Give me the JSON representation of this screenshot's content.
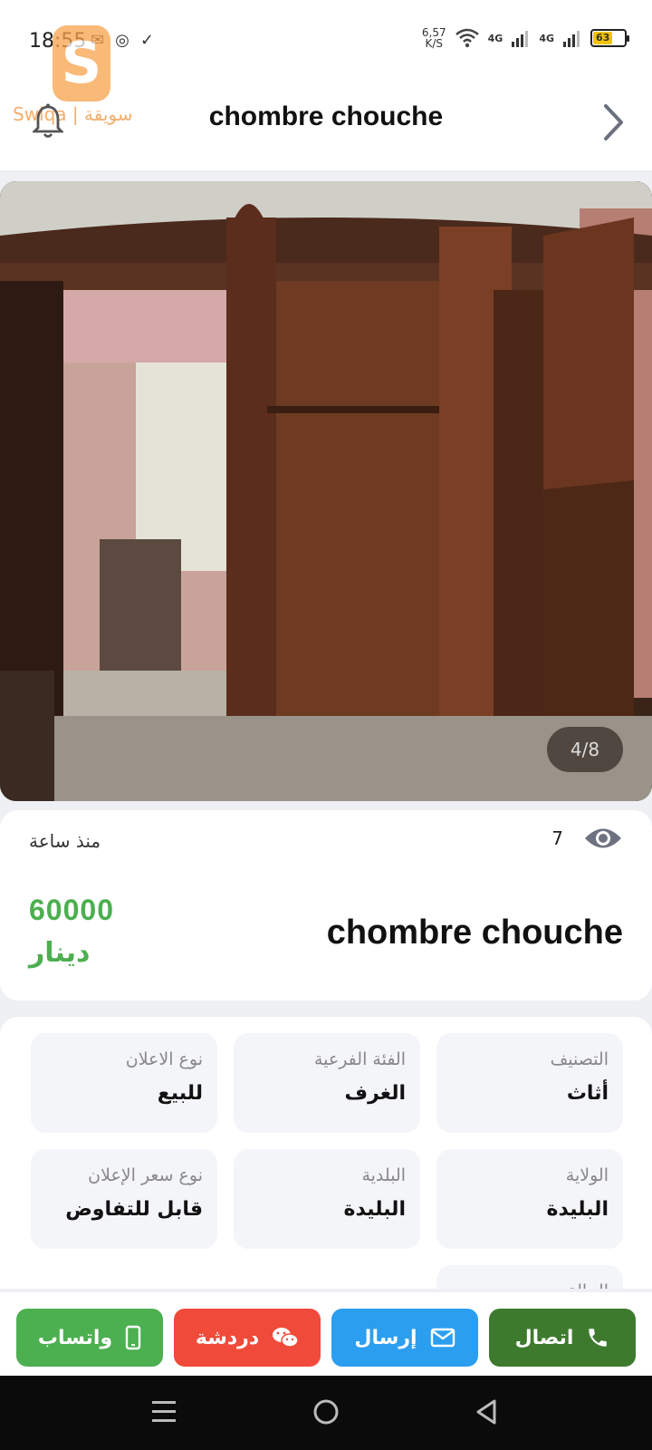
{
  "status_bar": {
    "time": "18:55",
    "net_speed_value": "6,57",
    "net_speed_unit": "K/S",
    "signal_1": "4G",
    "signal_2": "4G",
    "battery_level": "63"
  },
  "header": {
    "title": "chombre chouche",
    "logo_text": "Swiqa | سويقة"
  },
  "gallery": {
    "counter": "4/8"
  },
  "listing": {
    "posted": "منذ ساعة",
    "views": "7",
    "price": "60000",
    "currency": "دينار",
    "title": "chombre chouche"
  },
  "details": {
    "category_label": "التصنيف",
    "category_value": "أثاث",
    "subcategory_label": "الفئة الفرعية",
    "subcategory_value": "الغرف",
    "ad_type_label": "نوع الاعلان",
    "ad_type_value": "للبيع",
    "wilaya_label": "الولاية",
    "wilaya_value": "البليدة",
    "commune_label": "البلدية",
    "commune_value": "البليدة",
    "price_type_label": "نوع سعر الإعلان",
    "price_type_value": "قابل للتفاوض",
    "condition_label": "الحالة"
  },
  "actions": {
    "call": "اتصال",
    "send": "إرسال",
    "chat": "دردشة",
    "whatsapp": "واتساب"
  },
  "colors": {
    "price_green": "#4caf50",
    "call_green": "#3d7a2e",
    "send_blue": "#2c9ef0",
    "chat_red": "#f04a3a",
    "whatsapp_green": "#4caf50"
  }
}
